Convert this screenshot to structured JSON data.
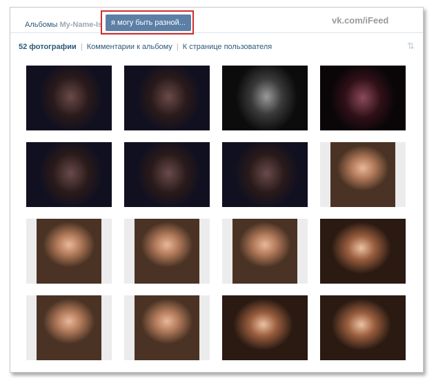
{
  "breadcrumb": {
    "albums_label": "Альбомы",
    "owner_name": "My-Name-Is"
  },
  "active_album": {
    "title": "я могу быть разной..."
  },
  "watermark": "vk.com/iFeed",
  "actions": {
    "photo_count": "52 фотографии",
    "comments_link": "Комментарии к альбому",
    "user_page_link": "К странице пользователя",
    "separator": "|"
  },
  "sort_icon": {
    "icon": "sort-arrows-icon",
    "glyph": "⇅"
  },
  "photos": [
    {
      "tone": "dark-blue"
    },
    {
      "tone": "dark-blue"
    },
    {
      "tone": "dark-gray"
    },
    {
      "tone": "dark-red"
    },
    {
      "tone": "dark-blue"
    },
    {
      "tone": "dark-blue"
    },
    {
      "tone": "dark-blue"
    },
    {
      "tone": "warm-portrait"
    },
    {
      "tone": "warm-portrait"
    },
    {
      "tone": "warm-portrait"
    },
    {
      "tone": "warm-portrait"
    },
    {
      "tone": "warm-landscape"
    },
    {
      "tone": "warm-portrait"
    },
    {
      "tone": "warm-portrait"
    },
    {
      "tone": "warm-landscape"
    },
    {
      "tone": "warm-landscape"
    }
  ],
  "colors": {
    "link": "#2b587a",
    "tab_active": "#5c7fa6",
    "highlight_border": "#d12a2a"
  }
}
